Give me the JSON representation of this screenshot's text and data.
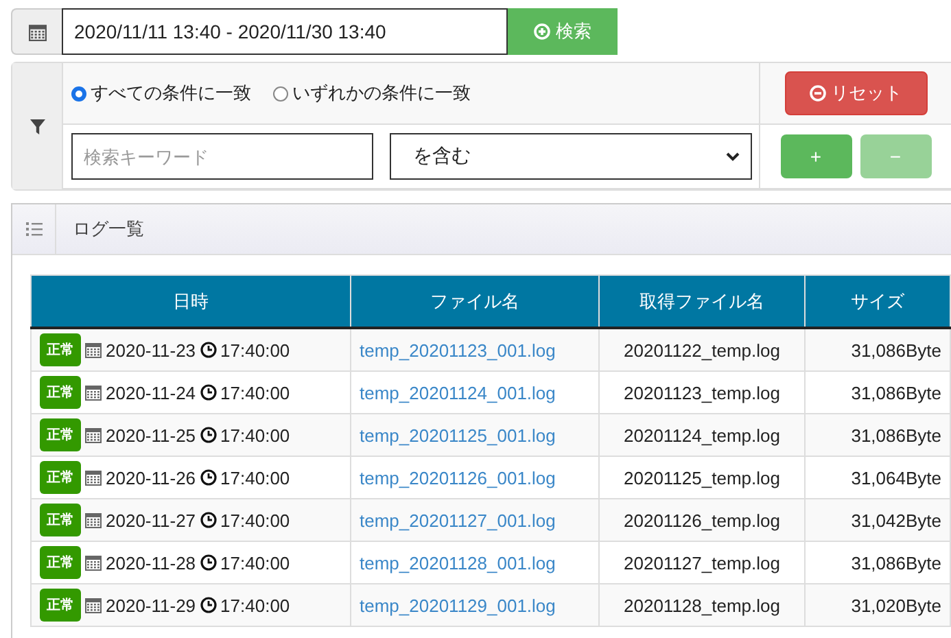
{
  "date_range": {
    "value": "2020/11/11 13:40 - 2020/11/30 13:40"
  },
  "search_button": {
    "label": "検索"
  },
  "filter": {
    "match_options": [
      {
        "label": "すべての条件に一致",
        "selected": true
      },
      {
        "label": "いずれかの条件に一致",
        "selected": false
      }
    ],
    "reset_button": {
      "label": "リセット"
    },
    "keyword": {
      "placeholder": "検索キーワード"
    },
    "condition": {
      "value": "を含む"
    },
    "add_button": {
      "label": "+",
      "disabled": false
    },
    "remove_button": {
      "label": "−",
      "disabled": true
    }
  },
  "log_panel": {
    "title": "ログ一覧",
    "table": {
      "columns": [
        "日時",
        "ファイル名",
        "取得ファイル名",
        "サイズ"
      ],
      "rows": [
        {
          "status": "正常",
          "date": "2020-11-23",
          "time": "17:40:00",
          "file": "temp_20201123_001.log",
          "fetched_file": "20201122_temp.log",
          "size": "31,086Byte"
        },
        {
          "status": "正常",
          "date": "2020-11-24",
          "time": "17:40:00",
          "file": "temp_20201124_001.log",
          "fetched_file": "20201123_temp.log",
          "size": "31,086Byte"
        },
        {
          "status": "正常",
          "date": "2020-11-25",
          "time": "17:40:00",
          "file": "temp_20201125_001.log",
          "fetched_file": "20201124_temp.log",
          "size": "31,086Byte"
        },
        {
          "status": "正常",
          "date": "2020-11-26",
          "time": "17:40:00",
          "file": "temp_20201126_001.log",
          "fetched_file": "20201125_temp.log",
          "size": "31,064Byte"
        },
        {
          "status": "正常",
          "date": "2020-11-27",
          "time": "17:40:00",
          "file": "temp_20201127_001.log",
          "fetched_file": "20201126_temp.log",
          "size": "31,042Byte"
        },
        {
          "status": "正常",
          "date": "2020-11-28",
          "time": "17:40:00",
          "file": "temp_20201128_001.log",
          "fetched_file": "20201127_temp.log",
          "size": "31,086Byte"
        },
        {
          "status": "正常",
          "date": "2020-11-29",
          "time": "17:40:00",
          "file": "temp_20201129_001.log",
          "fetched_file": "20201128_temp.log",
          "size": "31,020Byte"
        }
      ]
    }
  }
}
